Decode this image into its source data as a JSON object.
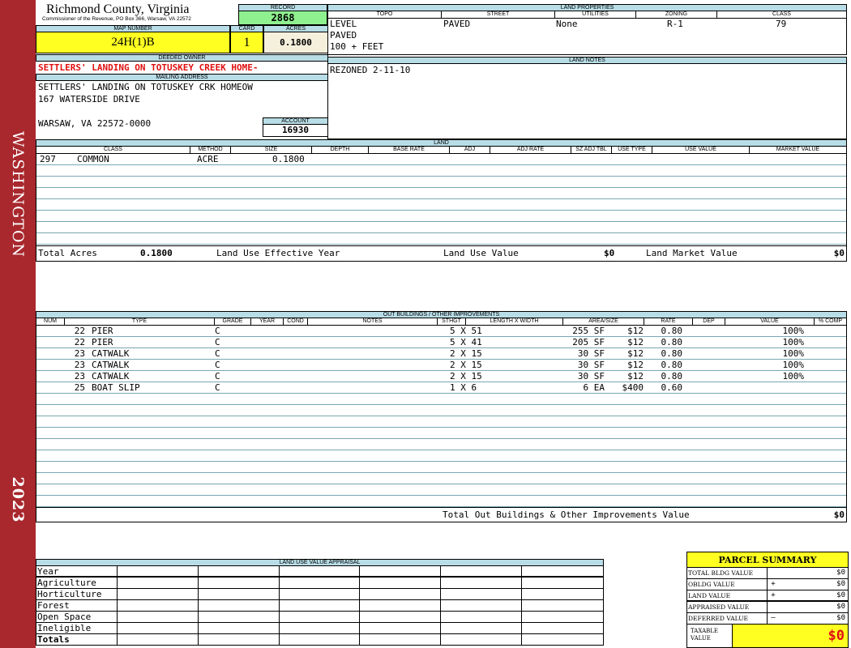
{
  "sidebar": {
    "name": "WASHINGTON",
    "year": "2023"
  },
  "header": {
    "county": "Richmond County, Virginia",
    "address": "Commissioner of the Revenue, PO Box 366, Warsaw, VA 22572",
    "record_label": "RECORD",
    "record": "2868",
    "map_label": "MAP NUMBER",
    "map": "24H(1)B",
    "card_label": "CARD",
    "card": "1",
    "acres_label": "ACRES",
    "acres": "0.1800"
  },
  "owner": {
    "deeded_label": "DEEDED OWNER",
    "deeded": "SETTLERS' LANDING ON TOTUSKEY CREEK HOME-",
    "mailing_label": "MAILING ADDRESS",
    "line1": "SETTLERS' LANDING ON TOTUSKEY CRK HOMEOW",
    "line2": "167 WATERSIDE DRIVE",
    "line3": "WARSAW, VA 22572-0000",
    "account_label": "ACCOUNT",
    "account": "16930"
  },
  "land_properties": {
    "title": "LAND PROPERTIES",
    "headers": [
      "TOPO",
      "STREET",
      "UTILITIES",
      "ZONING",
      "CLASS"
    ],
    "topo": [
      "LEVEL",
      "PAVED",
      "100 + FEET"
    ],
    "street": "PAVED",
    "utilities": "None",
    "zoning": "R-1",
    "class": "79"
  },
  "land_notes": {
    "title": "LAND NOTES",
    "text": "REZONED 2-11-10"
  },
  "land": {
    "title": "LAND",
    "headers": [
      "CLASS",
      "METHOD",
      "SIZE",
      "DEPTH",
      "BASE RATE",
      "ADJ",
      "ADJ RATE",
      "SZ ADJ TBL",
      "USE TYPE",
      "USE VALUE",
      "MARKET VALUE"
    ],
    "row": {
      "code": "297",
      "class": "COMMON",
      "method": "ACRE",
      "size": "0.1800"
    },
    "total_acres_label": "Total Acres",
    "total_acres": "0.1800",
    "eff_year_label": "Land Use Effective Year",
    "use_value_label": "Land Use Value",
    "use_value": "$0",
    "market_value_label": "Land Market Value",
    "market_value": "$0"
  },
  "outbuildings": {
    "title": "OUT BUILDINGS / OTHER IMPROVEMENTS",
    "headers": [
      "NUM",
      "TYPE",
      "GRADE",
      "YEAR",
      "COND",
      "NOTES",
      "STHGT",
      "LENGTH X WIDTH",
      "AREA/SIZE",
      "RATE",
      "DEP",
      "VALUE",
      "% COMP"
    ],
    "rows": [
      {
        "num": "22",
        "type": "PIER",
        "grade": "C",
        "lw": "5 X 51",
        "area": "255 SF",
        "rate": "$12",
        "dep": "0.80",
        "comp": "100%"
      },
      {
        "num": "22",
        "type": "PIER",
        "grade": "C",
        "lw": "5 X 41",
        "area": "205 SF",
        "rate": "$12",
        "dep": "0.80",
        "comp": "100%"
      },
      {
        "num": "23",
        "type": "CATWALK",
        "grade": "C",
        "lw": "2 X 15",
        "area": "30 SF",
        "rate": "$12",
        "dep": "0.80",
        "comp": "100%"
      },
      {
        "num": "23",
        "type": "CATWALK",
        "grade": "C",
        "lw": "2 X 15",
        "area": "30 SF",
        "rate": "$12",
        "dep": "0.80",
        "comp": "100%"
      },
      {
        "num": "23",
        "type": "CATWALK",
        "grade": "C",
        "lw": "2 X 15",
        "area": "30 SF",
        "rate": "$12",
        "dep": "0.80",
        "comp": "100%"
      },
      {
        "num": "25",
        "type": "BOAT SLIP",
        "grade": "C",
        "lw": "1 X 6",
        "area": "6 EA",
        "rate": "$400",
        "dep": "0.60",
        "comp": ""
      }
    ],
    "total_label": "Total Out Buildings & Other Improvements Value",
    "total": "$0"
  },
  "land_use": {
    "title": "LAND USE VALUE APPRAISAL",
    "rows": [
      "Year",
      "Agriculture",
      "Horticulture",
      "Forest",
      "Open Space",
      "Ineligible",
      "Totals"
    ]
  },
  "summary": {
    "title": "PARCEL SUMMARY",
    "rows": [
      {
        "label": "TOTAL BLDG VALUE",
        "sign": "",
        "value": "$0"
      },
      {
        "label": "OBLDG VALUE",
        "sign": "+",
        "value": "$0"
      },
      {
        "label": "LAND VALUE",
        "sign": "+",
        "value": "$0"
      },
      {
        "label": "APPRAISED VALUE",
        "sign": "",
        "value": "$0"
      },
      {
        "label": "DEFERRED VALUE",
        "sign": "–",
        "value": "$0"
      }
    ],
    "taxable_label": "TAXABLE VALUE",
    "taxable": "$0"
  }
}
